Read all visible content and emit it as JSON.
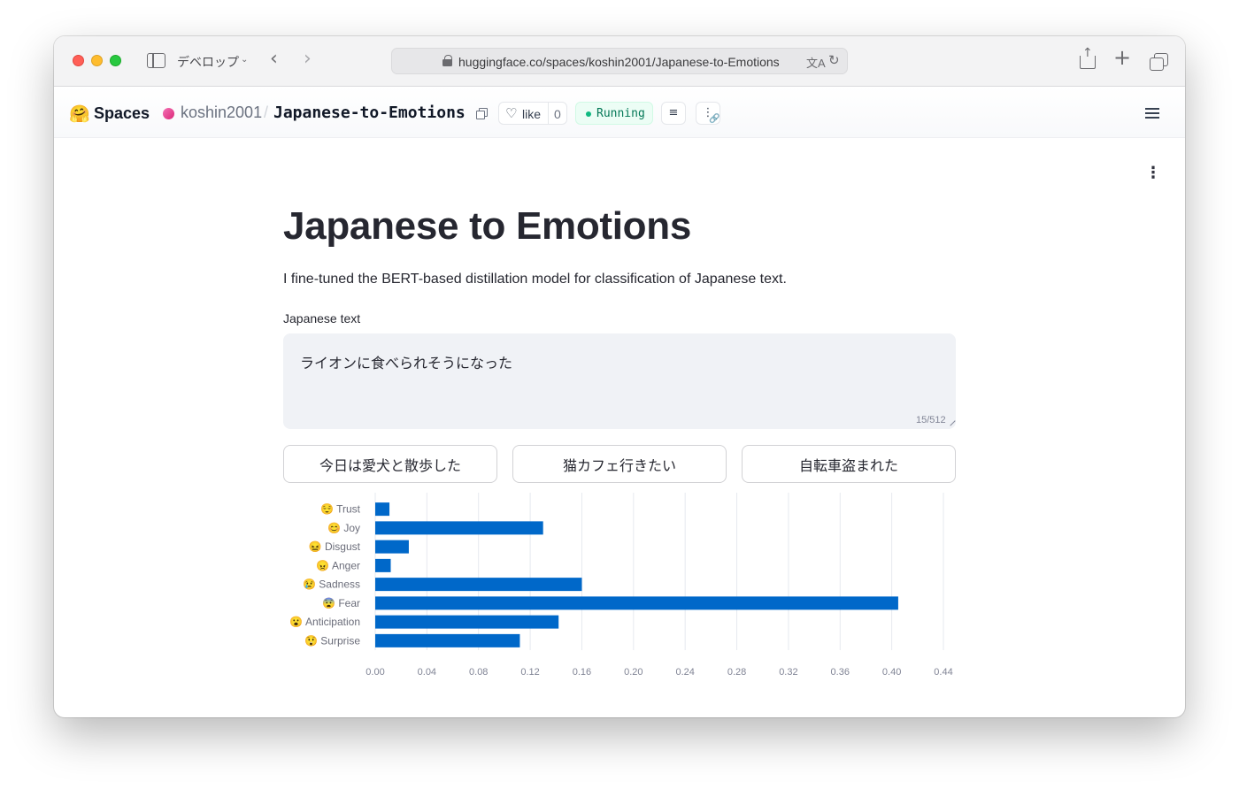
{
  "browser": {
    "dev_menu": "デベロップ",
    "url": "huggingface.co/spaces/koshin2001/Japanese-to-Emotions"
  },
  "hf_header": {
    "brand": "Spaces",
    "owner": "koshin2001",
    "separator": "/",
    "repo": "Japanese-to-Emotions",
    "like_label": "like",
    "like_count": "0",
    "status": "Running",
    "status_color": "#10b981"
  },
  "app": {
    "title": "Japanese to Emotions",
    "description": "I fine-tuned the BERT-based distillation model for classification of Japanese text.",
    "input_label": "Japanese text",
    "input_value": "ライオンに食べられそうになった",
    "char_count": "15/512",
    "examples": [
      "今日は愛犬と散歩した",
      "猫カフェ行きたい",
      "自転車盗まれた"
    ]
  },
  "chart_data": {
    "type": "bar",
    "orientation": "horizontal",
    "categories": [
      "😌 Trust",
      "😊 Joy",
      "😖 Disgust",
      "😠 Anger",
      "😢 Sadness",
      "😨 Fear",
      "😮 Anticipation",
      "😲 Surprise"
    ],
    "values": [
      0.011,
      0.13,
      0.026,
      0.012,
      0.16,
      0.405,
      0.142,
      0.112
    ],
    "xlim": [
      0,
      0.44
    ],
    "xticks": [
      "0.00",
      "0.04",
      "0.08",
      "0.12",
      "0.16",
      "0.20",
      "0.24",
      "0.28",
      "0.32",
      "0.36",
      "0.40",
      "0.44"
    ],
    "grid": true,
    "bar_color": "#0068c9"
  }
}
